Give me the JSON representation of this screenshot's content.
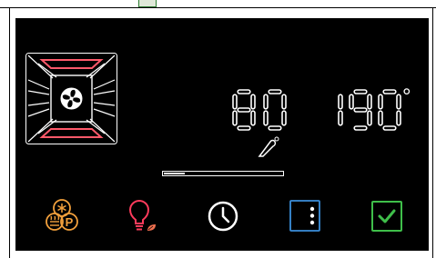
{
  "display": {
    "current_temperature": "80",
    "target_temperature": "190",
    "degree_symbol": "°",
    "progress_fraction": 0.18
  },
  "icons": {
    "oven_mode": "fan-heating-mode-icon",
    "core_probe": "meat-probe-icon",
    "functions": "fan-grill-pizza-functions-icon",
    "light": "oven-light-icon",
    "timer": "clock-icon",
    "door": "door-menu-icon",
    "confirm": "checkbox-confirm-icon"
  },
  "colors": {
    "heating_element": "#ff5a6b",
    "functions": "#f2a03c",
    "light": "#ff3b5c",
    "leaf": "#f07050",
    "timer": "#ffffff",
    "door": "#3b8fdb",
    "confirm": "#3fbf4a"
  }
}
